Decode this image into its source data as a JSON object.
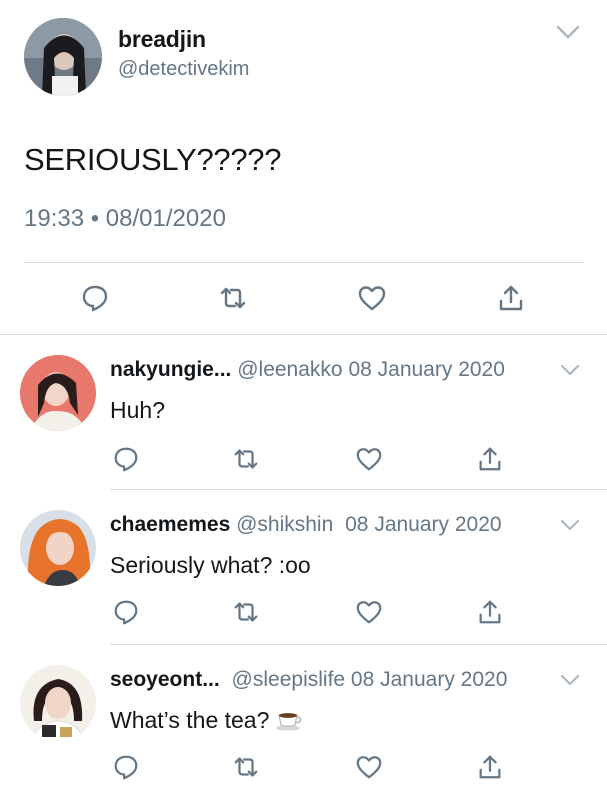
{
  "main_tweet": {
    "display_name": "breadjin",
    "handle": "@detectivekim",
    "text": "SERIOUSLY?????",
    "timestamp": "19:33 • 08/01/2020",
    "actions": [
      "reply-icon",
      "retweet-icon",
      "like-icon",
      "share-icon"
    ]
  },
  "replies": [
    {
      "display_name": "nakyungie...",
      "handle": "@leenakko",
      "date": "08 January 2020",
      "text": "Huh?"
    },
    {
      "display_name": "chaememes",
      "handle": "@shikshin",
      "date": "08 January 2020",
      "text": "Seriously what? :oo"
    },
    {
      "display_name": "seoyeont...",
      "handle": "@sleepislife",
      "date": "08 January 2020",
      "text": "What’s the tea?",
      "emoji": "teacup-icon"
    }
  ],
  "colors": {
    "text": "#14171a",
    "secondary": "#657786",
    "icon": "#657786",
    "divider": "#d8dde1"
  }
}
